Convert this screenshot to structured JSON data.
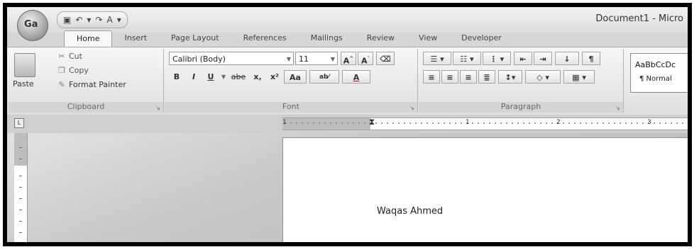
{
  "title_bar": {
    "document_title": "Document1 - Micro",
    "office_button_text": "Ga",
    "qat_items": [
      "save-icon",
      "undo-icon",
      "redo-icon",
      "font-color-icon"
    ]
  },
  "tabs": [
    "Home",
    "Insert",
    "Page Layout",
    "References",
    "Mailings",
    "Review",
    "View",
    "Developer"
  ],
  "clipboard": {
    "paste": "Paste",
    "cut": "Cut",
    "copy": "Copy",
    "format_painter": "Format Painter",
    "label": "Clipboard"
  },
  "font": {
    "font_name": "Calibri (Body)",
    "font_size": "11",
    "label": "Font",
    "row2": [
      "B",
      "I",
      "U",
      "abe",
      "x,",
      "x²",
      "Aa",
      "ab⁄",
      "A"
    ]
  },
  "paragraph": {
    "label": "Paragraph"
  },
  "styles": {
    "sample": "AaBbCcDc",
    "name": "¶ Normal"
  },
  "ruler": {
    "numbers": [
      "1",
      "1",
      "2",
      "3"
    ]
  },
  "document": {
    "text": "Waqas Ahmed"
  }
}
